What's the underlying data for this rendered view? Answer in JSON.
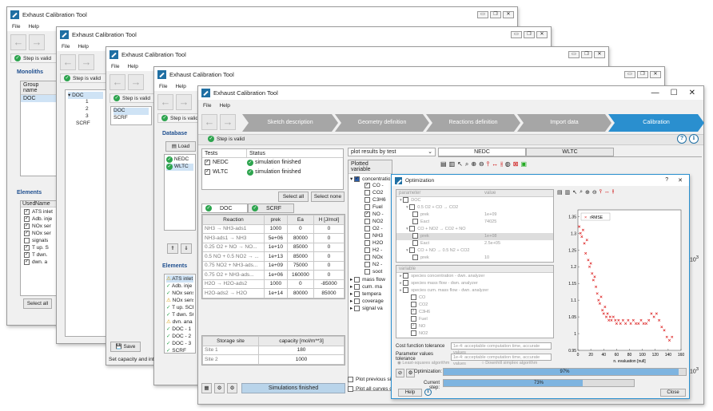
{
  "app_title": "Exhaust Calibration Tool",
  "menu": {
    "file": "File",
    "help": "Help"
  },
  "status_valid": "Step is valid",
  "win1": {
    "monoliths": "Monoliths",
    "group_header": "Group name",
    "group_row": "DOC",
    "elements": "Elements",
    "used": "Used",
    "name": "Name",
    "elements_list": [
      "ATS inlet",
      "Adb. inje",
      "NOx ser",
      "NOx ser",
      "signals",
      "T up. S",
      "T dwn.",
      "dwn. a"
    ],
    "select_all": "Select all"
  },
  "win2": {
    "tree": [
      "DOC",
      "1",
      "2",
      "3",
      "SCRF"
    ],
    "save": "Save",
    "status": "Set capacity and int"
  },
  "win3": {
    "status": "Step is valid"
  },
  "win4": {
    "list": [
      "DOC",
      "SCRF"
    ],
    "database": "Database",
    "load": "Load",
    "db_items": [
      "NEDC",
      "WLTC"
    ],
    "elements": "Elements",
    "elements_list": [
      "ATS inlet",
      "Adb. inje",
      "NOx sens",
      "NOx sens",
      "T up. SCR",
      "T dwn. SC",
      "dvn. ana",
      "DOC - 1",
      "DOC - 2",
      "DOC - 3",
      "SCRF"
    ]
  },
  "main": {
    "steps": [
      {
        "label": "Sketch description"
      },
      {
        "label": "Geometry definition"
      },
      {
        "label": "Reactions definition"
      },
      {
        "label": "Import data"
      },
      {
        "label": "Calibration"
      }
    ],
    "tests_header": "Tests",
    "status_header": "Status",
    "tests": [
      {
        "name": "NEDC",
        "status": "simulation finished"
      },
      {
        "name": "WLTC",
        "status": "simulation finished"
      }
    ],
    "select_all": "Select all",
    "select_none": "Select none",
    "tab_doc": "DOC",
    "tab_scrf": "SCRF",
    "reaction_headers": [
      "Reaction",
      "prek",
      "Ea",
      "H [J/mol]"
    ],
    "reactions": [
      [
        "NH3 → NH3-ads1",
        "1000",
        "0",
        "0"
      ],
      [
        "NH3-ads1 → NH3",
        "5e+06",
        "80000",
        "0"
      ],
      [
        "0.25 O2 + NO → NO...",
        "1e+10",
        "85000",
        "0"
      ],
      [
        "0.5 NO + 0.5 NO2 → ...",
        "1e+13",
        "85000",
        "0"
      ],
      [
        "0.75 NO2 + NH3-ads...",
        "1e+09",
        "75000",
        "0"
      ],
      [
        "0.75 O2 + NH3-ads...",
        "1e+06",
        "160000",
        "0"
      ],
      [
        "H2O → H2O-ads2",
        "1000",
        "0",
        "-85000"
      ],
      [
        "H2O-ads2 → H2O",
        "1e+14",
        "80000",
        "85000"
      ]
    ],
    "storage_headers": [
      "Storage site",
      "capacity [mol/m**3]"
    ],
    "storage": [
      [
        "Site 1",
        "180"
      ],
      [
        "Site 2",
        "1000"
      ]
    ],
    "sim_finished": "Simulations finished",
    "plot_select": "plot results by test",
    "plotted_variable": "Plotted variable",
    "variables": [
      "concentration",
      "CO -",
      "CO2",
      "C3H6",
      "Fuel",
      "NO -",
      "NO2",
      "O2 -",
      "NH3",
      "H2O",
      "H2 -",
      "NOx",
      "N2 -",
      "soot"
    ],
    "variables_more": [
      "mass flow",
      "cum. ma",
      "tempera",
      "coverage",
      "signal va"
    ],
    "plot_prev": "Plot previous sim",
    "plot_all": "Plot all curves c",
    "tab_nedc": "NEDC",
    "tab_wltc": "WLTC"
  },
  "opt": {
    "title": "Optimization",
    "col_param": "parameter",
    "col_value": "value",
    "params": [
      [
        "DOC",
        ""
      ],
      [
        "0.5 O2 + CO → CO2",
        ""
      ],
      [
        "prek",
        "1e+09"
      ],
      [
        "Eact",
        "74025"
      ],
      [
        "CO + NO2 → CO2 + NO",
        ""
      ],
      [
        "prek",
        "1e+08"
      ],
      [
        "Eact",
        "2.5e+05"
      ],
      [
        "CO + NO → 0.5 N2 + CO2",
        ""
      ],
      [
        "prek",
        "10"
      ]
    ],
    "var_header": "variable",
    "vars": [
      "species concentration - dwn. analyzer",
      "species mass flow - dwn. analyzer",
      "species cum. mass flow - dwn. analyzer",
      "CO",
      "CO2",
      "C3H6",
      "Fuel",
      "NO",
      "NO2"
    ],
    "cost_label": "Cost function tolerance",
    "cost_value": "1e-4: acceptable computation time, accurate values",
    "param_label": "Parameter values tolerance",
    "param_value": "1e-4: acceptable computation time, accurate values",
    "alg1": "Least-squares algorithm",
    "alg2": "Downhill simplex algorithm",
    "opt_label": "Optimization:",
    "opt_pct": "97%",
    "opt_val": 0.97,
    "cur_label": "Current step:",
    "cur_pct": "73%",
    "cur_val": 0.73,
    "help": "Help",
    "close": "Close",
    "question": "?",
    "legend": "rRMSE",
    "xlabel": "n. evaluation [null]",
    "yticks": [
      "1.35",
      "1.3",
      "1.25",
      "1.2",
      "1.15",
      "1.1",
      "1.05",
      "1",
      "0.95"
    ],
    "xticks": [
      "0",
      "20",
      "40",
      "60",
      "80",
      "100",
      "120",
      "140",
      "160"
    ]
  },
  "chart_data": {
    "type": "scatter",
    "series": [
      {
        "name": "rRMSE",
        "x": [
          2,
          4,
          6,
          8,
          10,
          12,
          14,
          16,
          18,
          20,
          22,
          24,
          26,
          28,
          30,
          32,
          34,
          36,
          38,
          40,
          42,
          44,
          46,
          48,
          50,
          52,
          55,
          58,
          60,
          63,
          66,
          70,
          74,
          78,
          82,
          86,
          90,
          94,
          98,
          102,
          106,
          110,
          114,
          118,
          122,
          126,
          130,
          134,
          138,
          142,
          146
        ],
        "y": [
          1.32,
          1.3,
          1.29,
          1.31,
          1.27,
          1.24,
          1.28,
          1.22,
          1.2,
          1.21,
          1.18,
          1.16,
          1.17,
          1.14,
          1.12,
          1.1,
          1.09,
          1.11,
          1.07,
          1.06,
          1.08,
          1.05,
          1.06,
          1.04,
          1.05,
          1.04,
          1.05,
          1.04,
          1.03,
          1.04,
          1.03,
          1.04,
          1.03,
          1.04,
          1.03,
          1.04,
          1.03,
          1.03,
          1.04,
          1.03,
          1.03,
          1.04,
          1.06,
          1.05,
          1.06,
          1.04,
          1.02,
          1.01,
          0.99,
          0.98,
          0.99
        ]
      }
    ],
    "xlim": [
      0,
      160
    ],
    "ylim": [
      0.95,
      1.37
    ],
    "xlabel": "n. evaluation [null]"
  }
}
